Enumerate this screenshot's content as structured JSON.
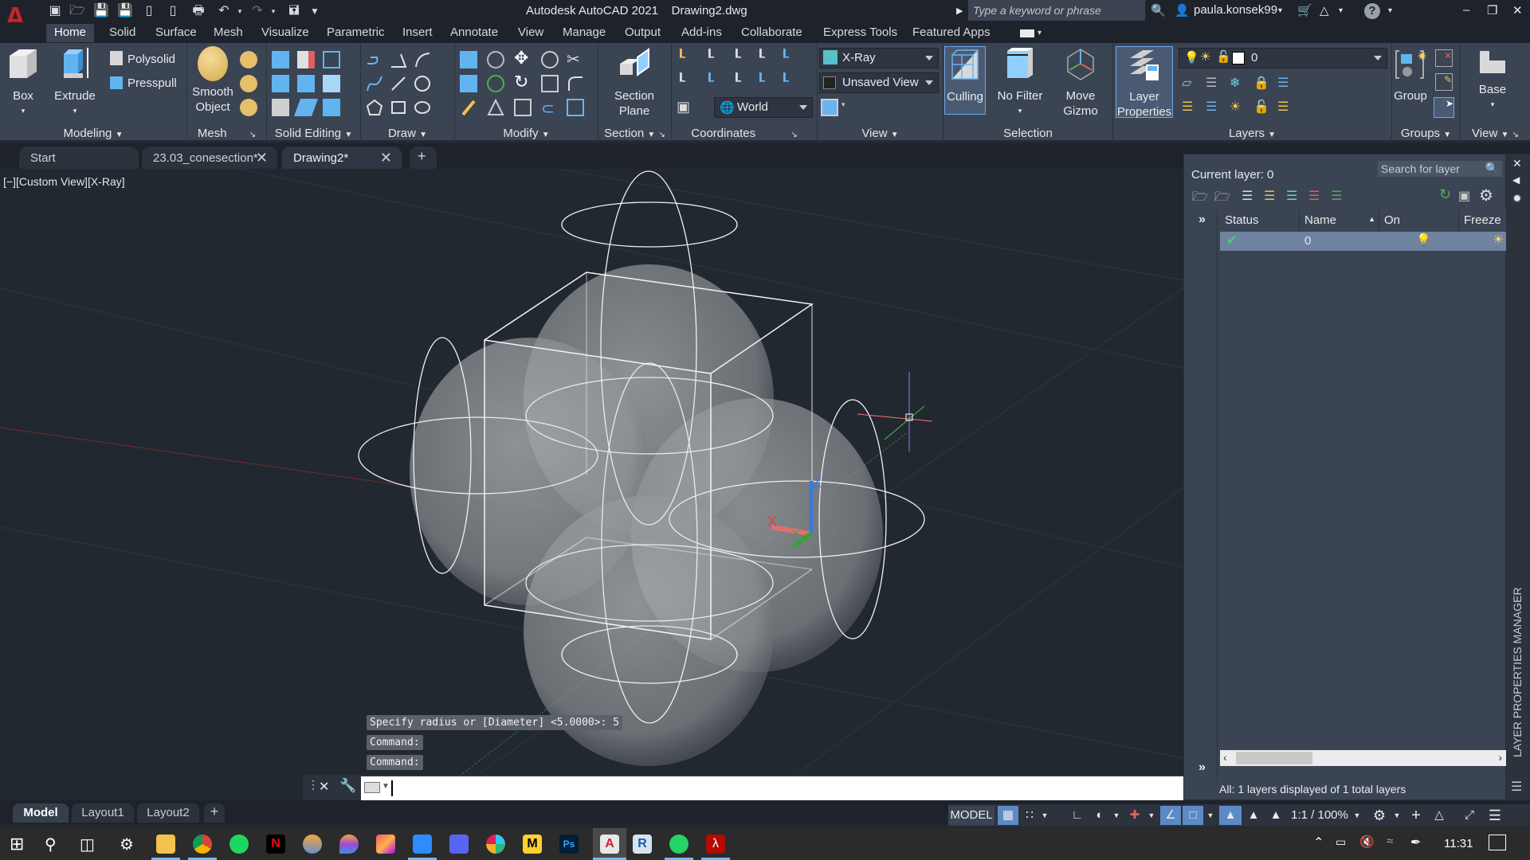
{
  "titlebar": {
    "app_title": "Autodesk AutoCAD 2021",
    "file_title": "Drawing2.dwg",
    "search_placeholder": "Type a keyword or phrase",
    "user": "paula.konsek99",
    "qat_icons": [
      "new-icon",
      "open-icon",
      "save-icon",
      "save-as-icon",
      "open-from-web-icon",
      "save-to-web-icon",
      "plot-icon",
      "undo-icon",
      "redo-icon",
      "workspace-icon",
      "customize-qat-icon"
    ]
  },
  "ribbon_tabs": [
    "Home",
    "Solid",
    "Surface",
    "Mesh",
    "Visualize",
    "Parametric",
    "Insert",
    "Annotate",
    "View",
    "Manage",
    "Output",
    "Add-ins",
    "Collaborate",
    "Express Tools",
    "Featured Apps"
  ],
  "ribbon": {
    "modeling": {
      "title": "Modeling",
      "box": "Box",
      "extrude": "Extrude",
      "polysolid": "Polysolid",
      "presspull": "Presspull"
    },
    "mesh": {
      "title": "Mesh",
      "smooth_object_1": "Smooth",
      "smooth_object_2": "Object"
    },
    "solid_editing": {
      "title": "Solid Editing"
    },
    "draw": {
      "title": "Draw"
    },
    "modify": {
      "title": "Modify"
    },
    "section": {
      "title": "Section",
      "btn_1": "Section",
      "btn_2": "Plane"
    },
    "coordinates": {
      "title": "Coordinates",
      "ucs": "World"
    },
    "view": {
      "title": "View",
      "visual_style": "X-Ray",
      "named_view": "Unsaved View"
    },
    "selection": {
      "title": "Selection",
      "culling": "Culling",
      "no_filter": "No Filter",
      "move_gizmo_1": "Move",
      "move_gizmo_2": "Gizmo"
    },
    "layers": {
      "title": "Layers",
      "layer_props_1": "Layer",
      "layer_props_2": "Properties",
      "current_layer": "0"
    },
    "groups": {
      "title": "Groups",
      "group": "Group"
    },
    "view2": {
      "title": "View",
      "base": "Base"
    }
  },
  "doc_tabs": [
    {
      "label": "Start",
      "closable": false
    },
    {
      "label": "23.03_conesection*",
      "closable": true
    },
    {
      "label": "Drawing2*",
      "closable": true,
      "active": true
    }
  ],
  "viewport": {
    "label": "[−][Custom View][X-Ray]",
    "ucs_x": "X",
    "ucs_y": "Y",
    "ucs_z": "Z"
  },
  "command_history": [
    "Specify radius or [Diameter] <5.0000>: 5",
    "Command:",
    "Command:"
  ],
  "command_input": {
    "value": ""
  },
  "layer_panel": {
    "current_layer": "Current layer: 0",
    "search_placeholder": "Search for layer",
    "columns": [
      "Status",
      "Name",
      "On",
      "Freeze"
    ],
    "rows": [
      {
        "status": "current",
        "name": "0",
        "on": true,
        "freeze": false
      }
    ],
    "footer": "All: 1 layers displayed of 1 total layers",
    "side_title": "LAYER PROPERTIES MANAGER"
  },
  "layout_tabs": [
    {
      "label": "Model",
      "active": true
    },
    {
      "label": "Layout1"
    },
    {
      "label": "Layout2"
    }
  ],
  "statusbar": {
    "space": "MODEL",
    "annotation_scale": "1:1 / 100%"
  },
  "taskbar": {
    "apps": [
      "file-explorer",
      "chrome",
      "spotify",
      "netflix",
      "firefox-variant",
      "paint",
      "creative-cloud",
      "zoom",
      "discord",
      "slack",
      "miro",
      "photoshop",
      "autocad",
      "revit",
      "whatsapp",
      "acrobat"
    ],
    "time": "11:31"
  }
}
